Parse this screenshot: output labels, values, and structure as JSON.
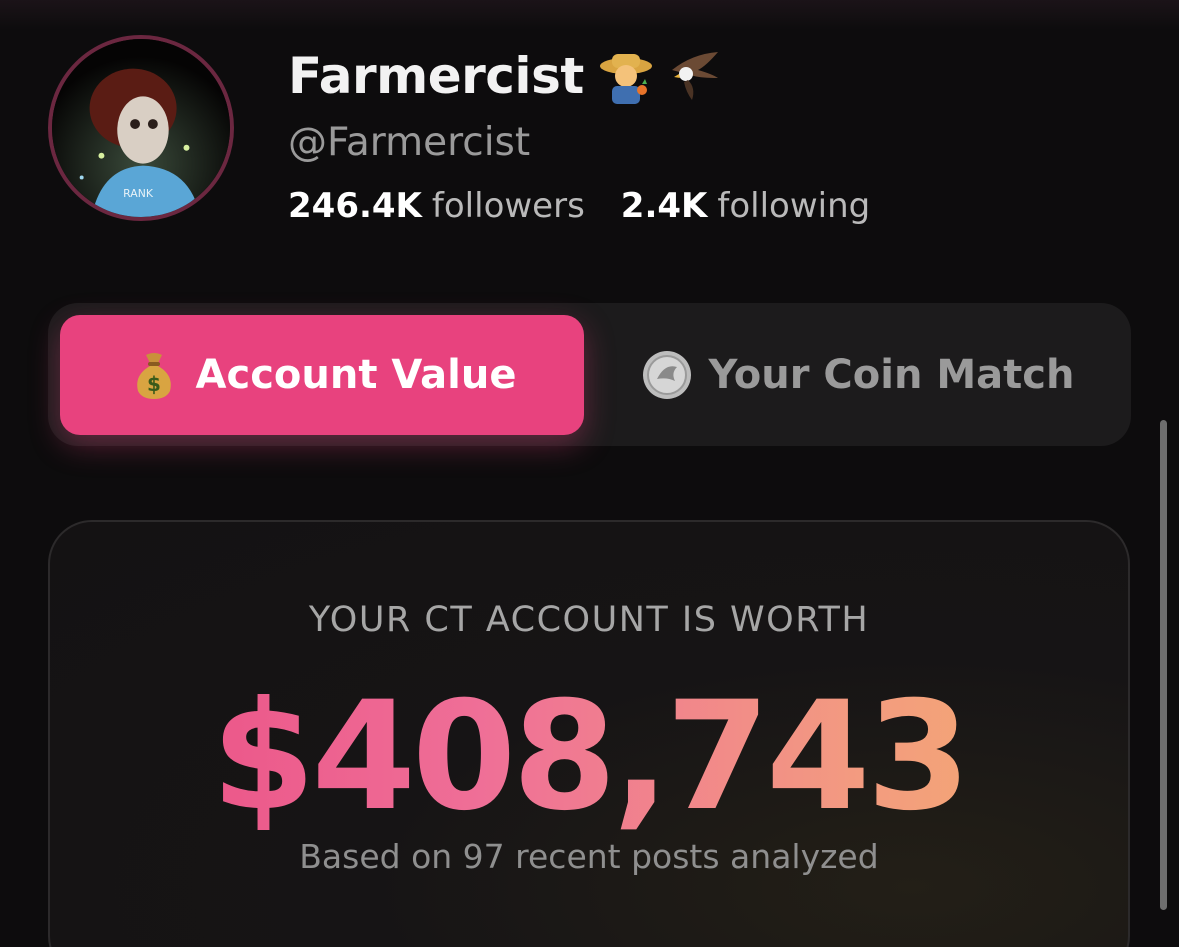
{
  "profile": {
    "display_name": "Farmercist",
    "handle": "@Farmercist",
    "badges": [
      "farmer-emoji-icon",
      "eagle-emoji-icon"
    ],
    "followers_count": "246.4K",
    "followers_label": "followers",
    "following_count": "2.4K",
    "following_label": "following"
  },
  "tabs": [
    {
      "label": "Account Value",
      "icon": "money-bag-icon",
      "active": true
    },
    {
      "label": "Your Coin Match",
      "icon": "coin-icon",
      "active": false
    }
  ],
  "card": {
    "label": "YOUR CT ACCOUNT IS WORTH",
    "value": "$408,743",
    "footnote": "Based on 97 recent posts analyzed"
  },
  "colors": {
    "accent": "#e8427e",
    "background": "#0d0c0d",
    "value_gradient": [
      "#ea4a82",
      "#f4b06a"
    ]
  }
}
